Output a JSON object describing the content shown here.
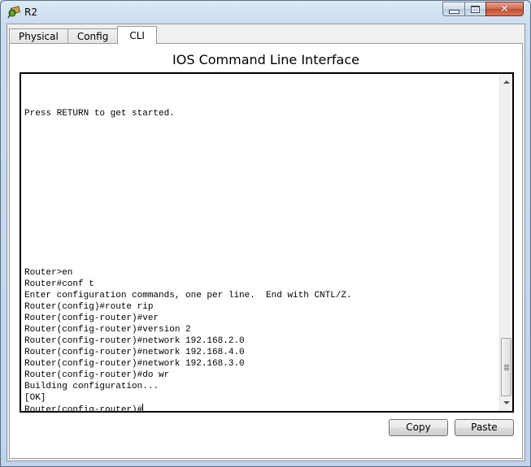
{
  "window": {
    "title": "R2",
    "icon": "router-device-icon",
    "controls": {
      "minimize": "minimize",
      "maximize": "maximize",
      "close": "✕"
    }
  },
  "tabs": [
    {
      "label": "Physical",
      "active": false
    },
    {
      "label": "Config",
      "active": false
    },
    {
      "label": "CLI",
      "active": true
    }
  ],
  "panel": {
    "title": "IOS Command Line Interface"
  },
  "console": {
    "lines": [
      "",
      "",
      "",
      "Press RETURN to get started.",
      "",
      "",
      "",
      "",
      "",
      "",
      "",
      "",
      "",
      "",
      "",
      "",
      "",
      "Router>en",
      "Router#conf t",
      "Enter configuration commands, one per line.  End with CNTL/Z.",
      "Router(config)#route rip",
      "Router(config-router)#ver",
      "Router(config-router)#version 2",
      "Router(config-router)#network 192.168.2.0",
      "Router(config-router)#network 192.168.4.0",
      "Router(config-router)#network 192.168.3.0",
      "Router(config-router)#do wr",
      "Building configuration...",
      "[OK]"
    ],
    "prompt": "Router(config-router)#"
  },
  "buttons": {
    "copy": "Copy",
    "paste": "Paste"
  }
}
